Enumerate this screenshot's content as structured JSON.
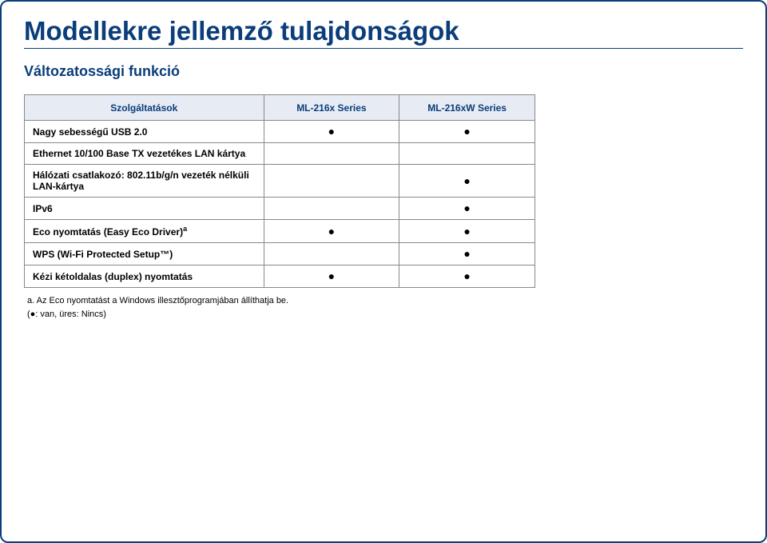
{
  "title": "Modellekre jellemző tulajdonságok",
  "subtitle": "Változatossági funkció",
  "table": {
    "headers": [
      "Szolgáltatások",
      "ML-216x Series",
      "ML-216xW Series"
    ],
    "rows": [
      {
        "label": "Nagy sebességű USB 2.0",
        "c1": "●",
        "c2": "●"
      },
      {
        "label": "Ethernet 10/100 Base TX vezetékes LAN kártya",
        "c1": "",
        "c2": ""
      },
      {
        "label": "Hálózati csatlakozó: 802.11b/g/n vezeték nélküli LAN-kártya",
        "c1": "",
        "c2": "●"
      },
      {
        "label": "IPv6",
        "c1": "",
        "c2": "●"
      },
      {
        "label_prefix": "Eco nyomtatás (Easy Eco Driver)",
        "label_sup": "a",
        "c1": "●",
        "c2": "●",
        "has_sup": true
      },
      {
        "label": "WPS (Wi-Fi Protected Setup™)",
        "c1": "",
        "c2": "●"
      },
      {
        "label": "Kézi kétoldalas (duplex) nyomtatás",
        "c1": "●",
        "c2": "●"
      }
    ]
  },
  "footnote_a": "a. Az Eco nyomtatást a Windows illesztőprogramjában állíthatja be.",
  "footnote_legend": "(●: van, üres: Nincs)"
}
